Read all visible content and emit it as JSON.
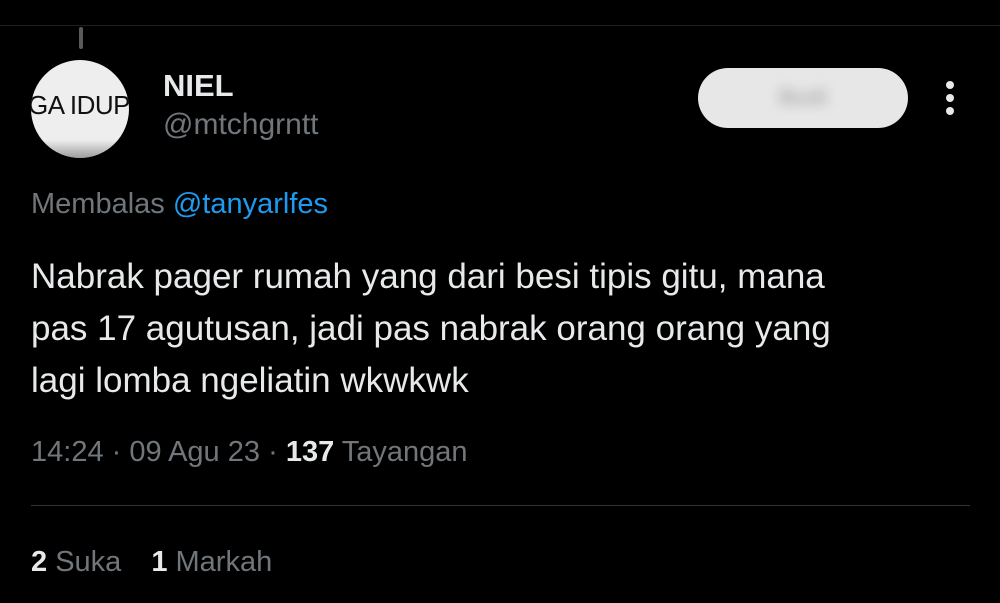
{
  "tweet": {
    "avatar_text": "GA IDUP",
    "display_name": "NIEL",
    "handle": "@mtchgrntt",
    "follow_label": "Ikuti",
    "more_icon": "more-vertical-icon",
    "reply_prefix": "Membalas",
    "reply_mention": "@tanyarlfes",
    "text": "Nabrak pager rumah yang dari besi tipis gitu, mana\npas 17 agutusan, jadi pas nabrak orang orang yang\nlagi lomba ngeliatin wkwkwk",
    "time": "14:24",
    "date": "09 Agu 23",
    "separator": "·",
    "views_count": "137",
    "views_label": "Tayangan"
  },
  "stats": {
    "likes_count": "2",
    "likes_label": "Suka",
    "bookmarks_count": "1",
    "bookmarks_label": "Markah"
  },
  "colors": {
    "background": "#000000",
    "text_primary": "#e7e9ea",
    "text_secondary": "#71767b",
    "link": "#1d9bf0",
    "divider": "#2f3336"
  }
}
